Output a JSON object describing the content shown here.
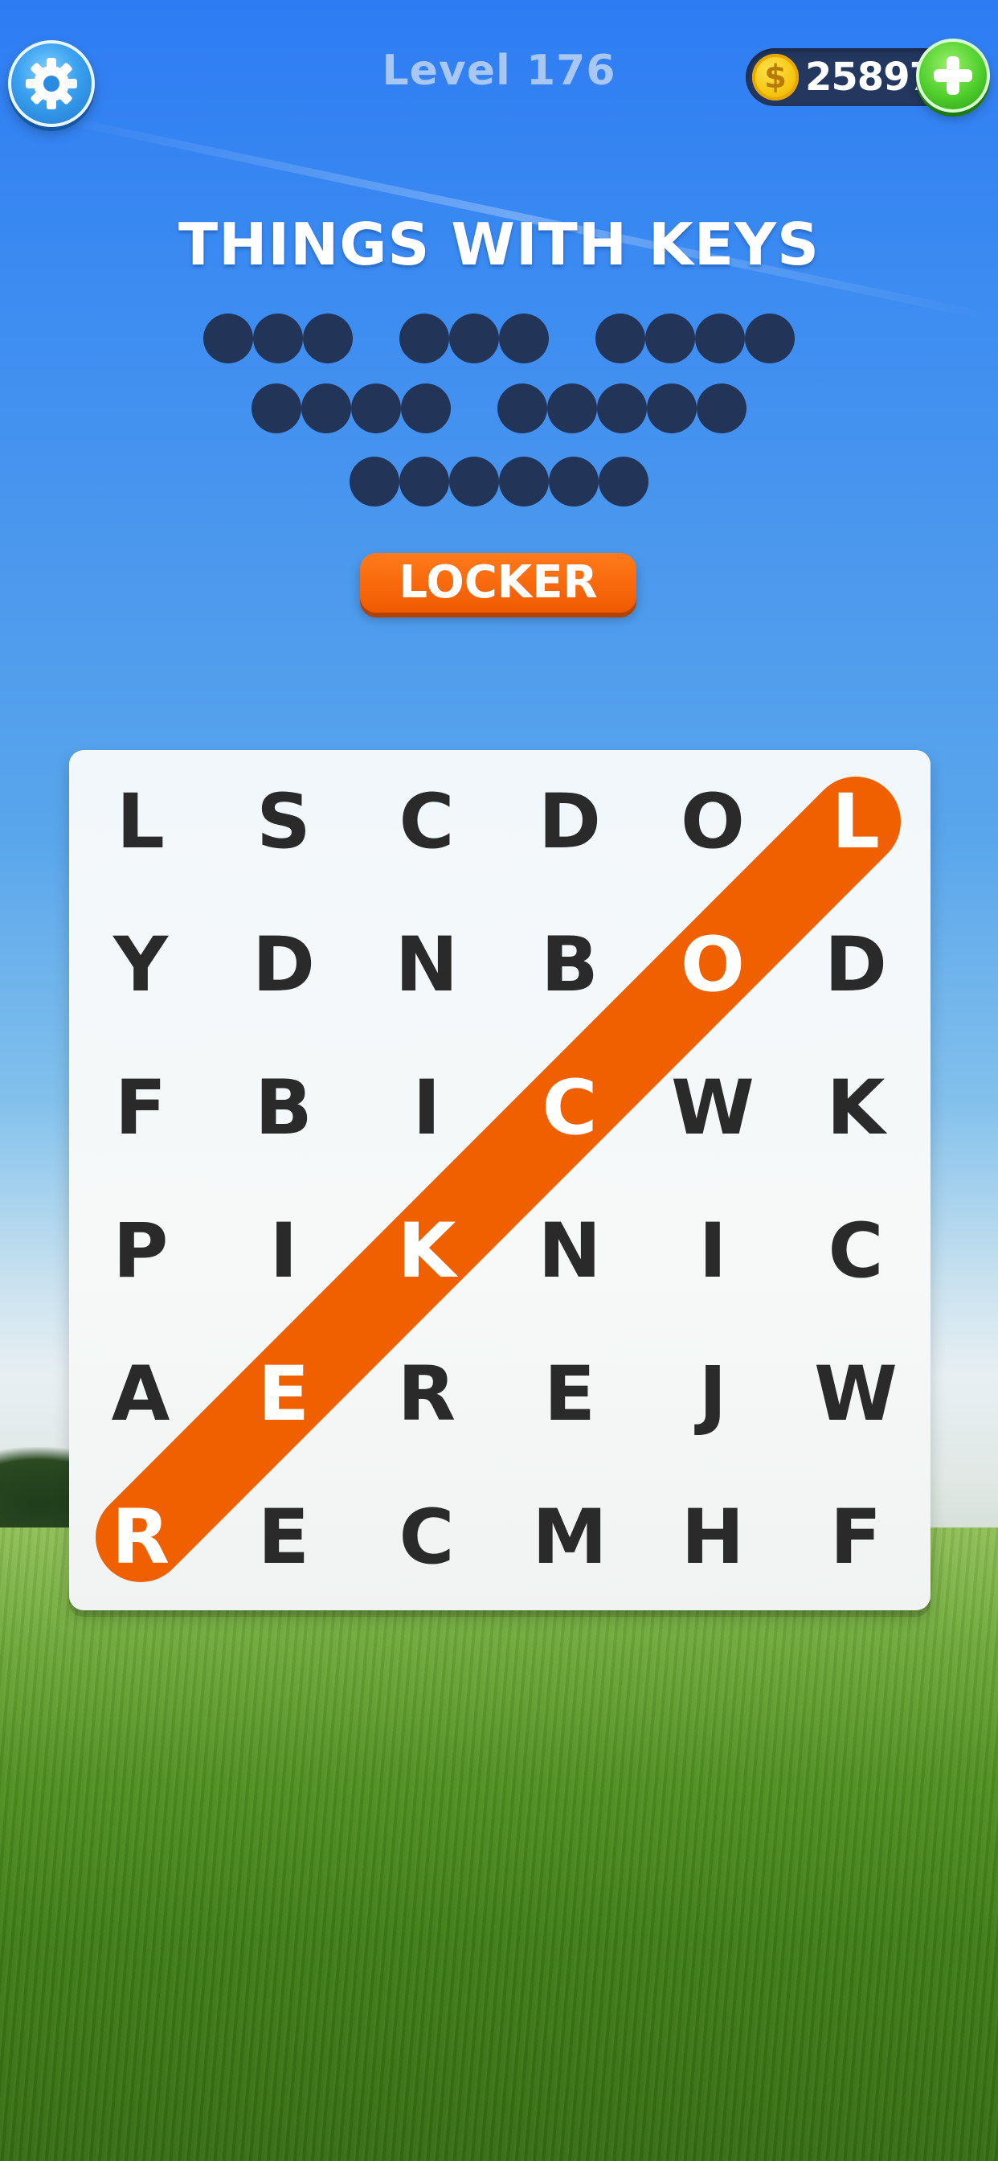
{
  "header": {
    "level_label": "Level 176",
    "coins": "25897",
    "coin_symbol": "$"
  },
  "puzzle": {
    "category": "THINGS WITH KEYS",
    "found_word": "LOCKER",
    "word_lengths": [
      [
        3,
        3,
        4
      ],
      [
        4,
        5
      ],
      [
        6
      ]
    ]
  },
  "grid": {
    "rows": [
      [
        "L",
        "S",
        "C",
        "D",
        "O",
        "L"
      ],
      [
        "Y",
        "D",
        "N",
        "B",
        "O",
        "D"
      ],
      [
        "F",
        "B",
        "I",
        "C",
        "W",
        "K"
      ],
      [
        "P",
        "I",
        "K",
        "N",
        "I",
        "C"
      ],
      [
        "A",
        "E",
        "R",
        "E",
        "J",
        "W"
      ],
      [
        "R",
        "E",
        "C",
        "M",
        "H",
        "F"
      ]
    ],
    "highlighted_cells": [
      [
        0,
        5
      ],
      [
        1,
        4
      ],
      [
        2,
        3
      ],
      [
        3,
        2
      ],
      [
        4,
        1
      ],
      [
        5,
        0
      ]
    ]
  },
  "colors": {
    "highlight": "#f06000",
    "hidden_letter_dot": "#223458",
    "found_tag": "#f26000",
    "letter": "#2a2a2a"
  },
  "icons": {
    "settings": "gear-icon",
    "coin": "coin-icon",
    "add": "plus-icon"
  }
}
